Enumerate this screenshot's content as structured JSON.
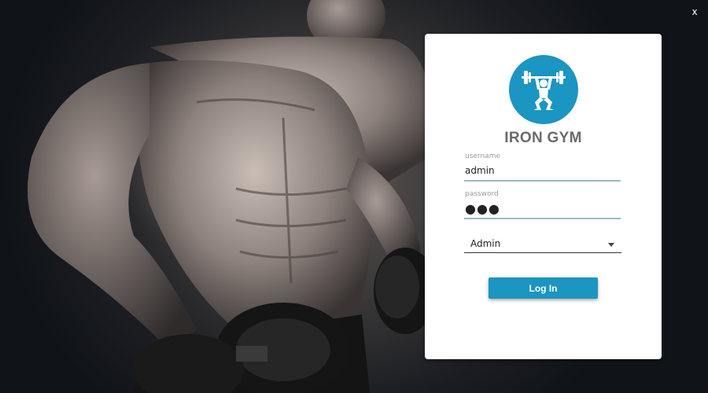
{
  "window": {
    "close_label": "x"
  },
  "background": {
    "description_icon": "bodybuilder-with-dumbbells-photo"
  },
  "login": {
    "logo_icon": "weightlifter-icon",
    "brand_title": "IRON GYM",
    "username": {
      "label": "username",
      "value": "admin"
    },
    "password": {
      "label": "password",
      "value": "●●●"
    },
    "role": {
      "selected": "Admin"
    },
    "submit_label": "Log In"
  },
  "colors": {
    "accent": "#1b95c1",
    "title_text": "#6b6b6b",
    "field_underline": "#9bbac4",
    "card_bg": "#ffffff",
    "window_bg": "#12151b"
  }
}
